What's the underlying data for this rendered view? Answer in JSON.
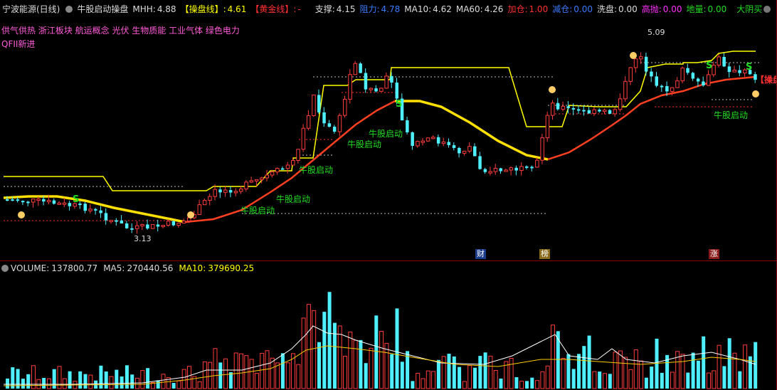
{
  "header": {
    "stock": "宁波能源(日线)",
    "indicator": "牛股启动操盘",
    "mhh_label": "MHH:",
    "mhh": "4.88",
    "czx_label": "【操盘线】:",
    "czx": "4.61",
    "hjx_label": "【黄金线】:",
    "hjx": "-",
    "support_label": "支撑:",
    "support": "4.15",
    "resist_label": "阻力:",
    "resist": "4.78",
    "ma10_label": "MA10:",
    "ma10": "4.62",
    "ma60_label": "MA60:",
    "ma60": "4.26",
    "add_label": "加仓:",
    "add": "1.00",
    "reduce_label": "减仓:",
    "reduce": "0.00",
    "wash_label": "洗盘:",
    "wash": "0.00",
    "high_label": "高抛:",
    "high": "0.00",
    "low_label": "地量:",
    "low": "0.00",
    "right_label": "大阴买"
  },
  "concepts": "供气供热 浙江板块 航运概念 光伏 生物质能 工业气体 绿色电力",
  "qfii": "QFII新进",
  "labels": {
    "bull_start": "牛股启动",
    "high_price": "5.09",
    "low_price": "3.13",
    "s_marker": "S",
    "side_label": "【操盘",
    "cai": "财",
    "bang": "榜",
    "zhang": "涨"
  },
  "volume": {
    "volume_label": "VOLUME:",
    "volume": "137800.77",
    "ma5_label": "MA5:",
    "ma5": "270440.56",
    "ma10_label": "MA10:",
    "ma10": "379690.25"
  },
  "colors": {
    "up": "#ff3c3c",
    "down": "#4ef0ff",
    "yellow_line": "#ffff00",
    "ma_line": "#ffcc00",
    "red_line": "#ff3030",
    "bull_text": "#22dd22"
  }
}
